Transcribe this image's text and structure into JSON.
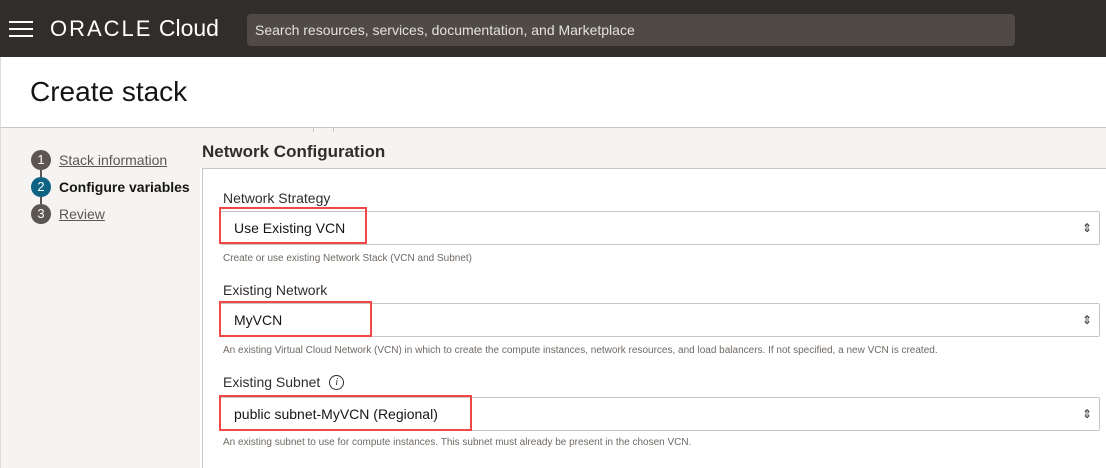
{
  "header": {
    "brand": "ORACLE",
    "product": "Cloud",
    "search_placeholder": "Search resources, services, documentation, and Marketplace"
  },
  "page_title": "Create stack",
  "steps": [
    {
      "num": "1",
      "label": "Stack information",
      "state": "link"
    },
    {
      "num": "2",
      "label": "Configure variables",
      "state": "active"
    },
    {
      "num": "3",
      "label": "Review",
      "state": "link"
    }
  ],
  "section_title": "Network Configuration",
  "fields": [
    {
      "label": "Network Strategy",
      "value": "Use Existing VCN",
      "help": "Create or use existing Network Stack (VCN and Subnet)"
    },
    {
      "label": "Existing Network",
      "value": "MyVCN",
      "help": "An existing Virtual Cloud Network (VCN) in which to create the compute instances, network resources, and load balancers. If not specified, a new VCN is created."
    },
    {
      "label": "Existing Subnet",
      "value": "public subnet-MyVCN (Regional)",
      "help": "An existing subnet to use for compute instances. This subnet must already be present in the chosen VCN."
    }
  ],
  "colors": {
    "header": "#312d2a",
    "active_step": "#0e6284",
    "highlight": "#f04848"
  }
}
